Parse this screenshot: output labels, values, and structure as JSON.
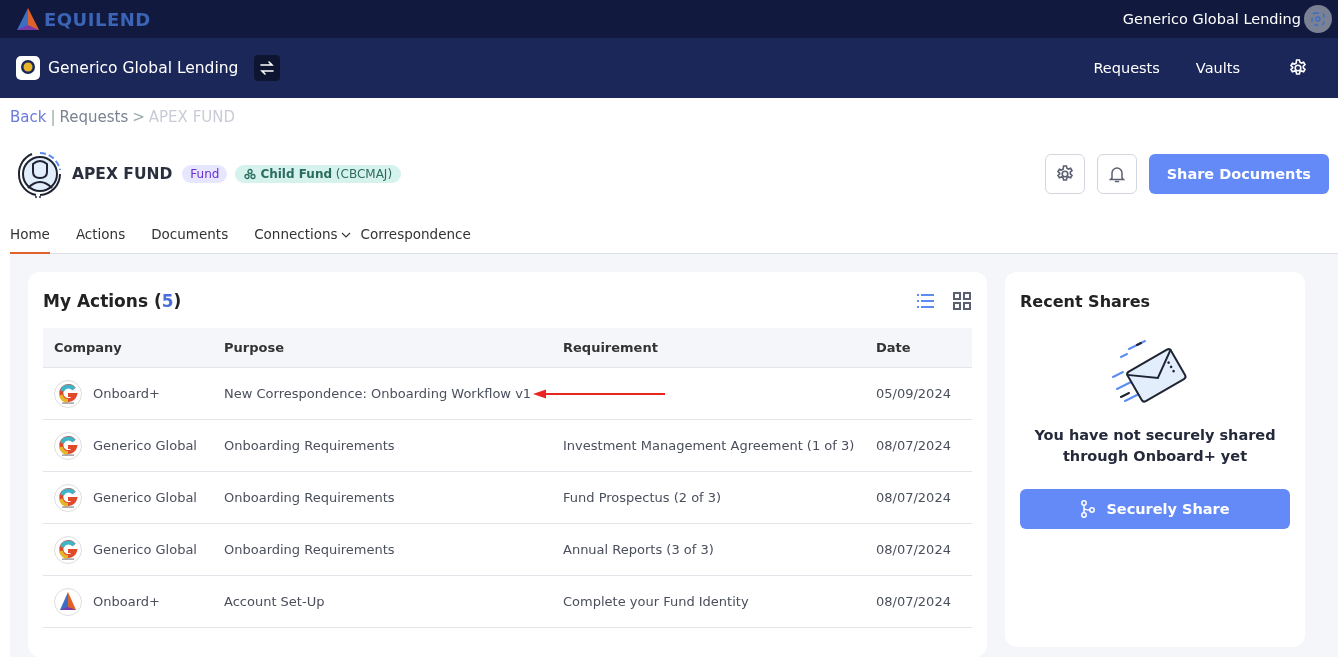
{
  "top_bar": {
    "logo": "EQUILEND",
    "user": "Generico Global Lending"
  },
  "nav_bar": {
    "org": "Generico Global Lending",
    "links": [
      "Requests",
      "Vaults"
    ]
  },
  "breadcrumb": [
    {
      "label": "Back",
      "kind": "link"
    },
    {
      "label": "|",
      "kind": "separator"
    },
    {
      "label": "Requests",
      "kind": "link"
    },
    {
      "label": ">",
      "kind": "separator"
    },
    {
      "label": "APEX FUND",
      "kind": "current"
    }
  ],
  "entity": {
    "name": "APEX FUND",
    "type_badge": "Fund",
    "relation_badge": "**Child Fund** (CBCMAJ)",
    "primary_button": "Share Documents"
  },
  "tabs": [
    {
      "label": "Home",
      "selected": true
    },
    {
      "label": "Actions",
      "selected": false
    },
    {
      "label": "Documents",
      "selected": false
    },
    {
      "label": "Connections",
      "selected": false,
      "dropdown": true
    },
    {
      "label": "Correspondence",
      "selected": false
    }
  ],
  "my_actions": {
    "title": "My Actions",
    "open_paren": "(",
    "count": "5",
    "close_paren": ")",
    "views": [
      {
        "kind": "list",
        "selected": true
      },
      {
        "kind": "grid",
        "selected": false
      }
    ],
    "table": {
      "columns": [
        "Company",
        "Purpose",
        "Requirement",
        "Date"
      ],
      "rows": [
        {
          "kind": "generico",
          "company": "Onboard+",
          "purpose": "New Correspondence: Onboarding Workflow v1",
          "date": "05/09/2024",
          "pointer": true
        },
        {
          "kind": "generico",
          "company": "Generico Global",
          "purpose": "Onboarding Requirements",
          "requirement": "Investment Management Agreement (1 of 3)",
          "date": "08/07/2024",
          "pointer": false
        },
        {
          "kind": "generico",
          "company": "Generico Global",
          "purpose": "Onboarding Requirements",
          "requirement": "Fund Prospectus (2 of 3)",
          "date": "08/07/2024",
          "pointer": false
        },
        {
          "kind": "generico",
          "company": "Generico Global",
          "purpose": "Onboarding Requirements",
          "requirement": "Annual Reports (3 of 3)",
          "date": "08/07/2024",
          "pointer": false
        },
        {
          "kind": "equilend",
          "company": "Onboard+",
          "purpose": "Account Set-Up",
          "requirement": "Complete your Fund Identity",
          "date": "08/07/2024",
          "pointer": false
        }
      ]
    }
  },
  "recent_shares": {
    "title": "Recent Shares",
    "empty_message": "You have not securely shared through Onboard+ yet",
    "button": "Securely Share"
  }
}
